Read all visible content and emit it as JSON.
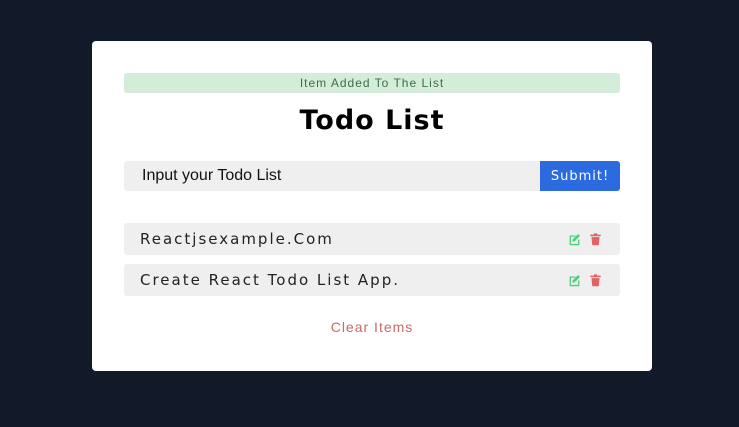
{
  "alert": {
    "text": "Item Added To The List",
    "color": "#d4eddb"
  },
  "title": "Todo List",
  "form": {
    "placeholder": "Input your Todo List",
    "value": "",
    "submit_label": "Submit!",
    "submit_color": "#2b6bdf"
  },
  "items": [
    {
      "text": "Reactjsexample.Com",
      "edit_icon": "edit-icon",
      "delete_icon": "trash-icon"
    },
    {
      "text": "Create React Todo List App.",
      "edit_icon": "edit-icon",
      "delete_icon": "trash-icon"
    }
  ],
  "clear_label": "Clear Items",
  "colors": {
    "background": "#121a2a",
    "edit": "#4cd07a",
    "delete": "#e06464",
    "clear": "#c96a6a"
  }
}
